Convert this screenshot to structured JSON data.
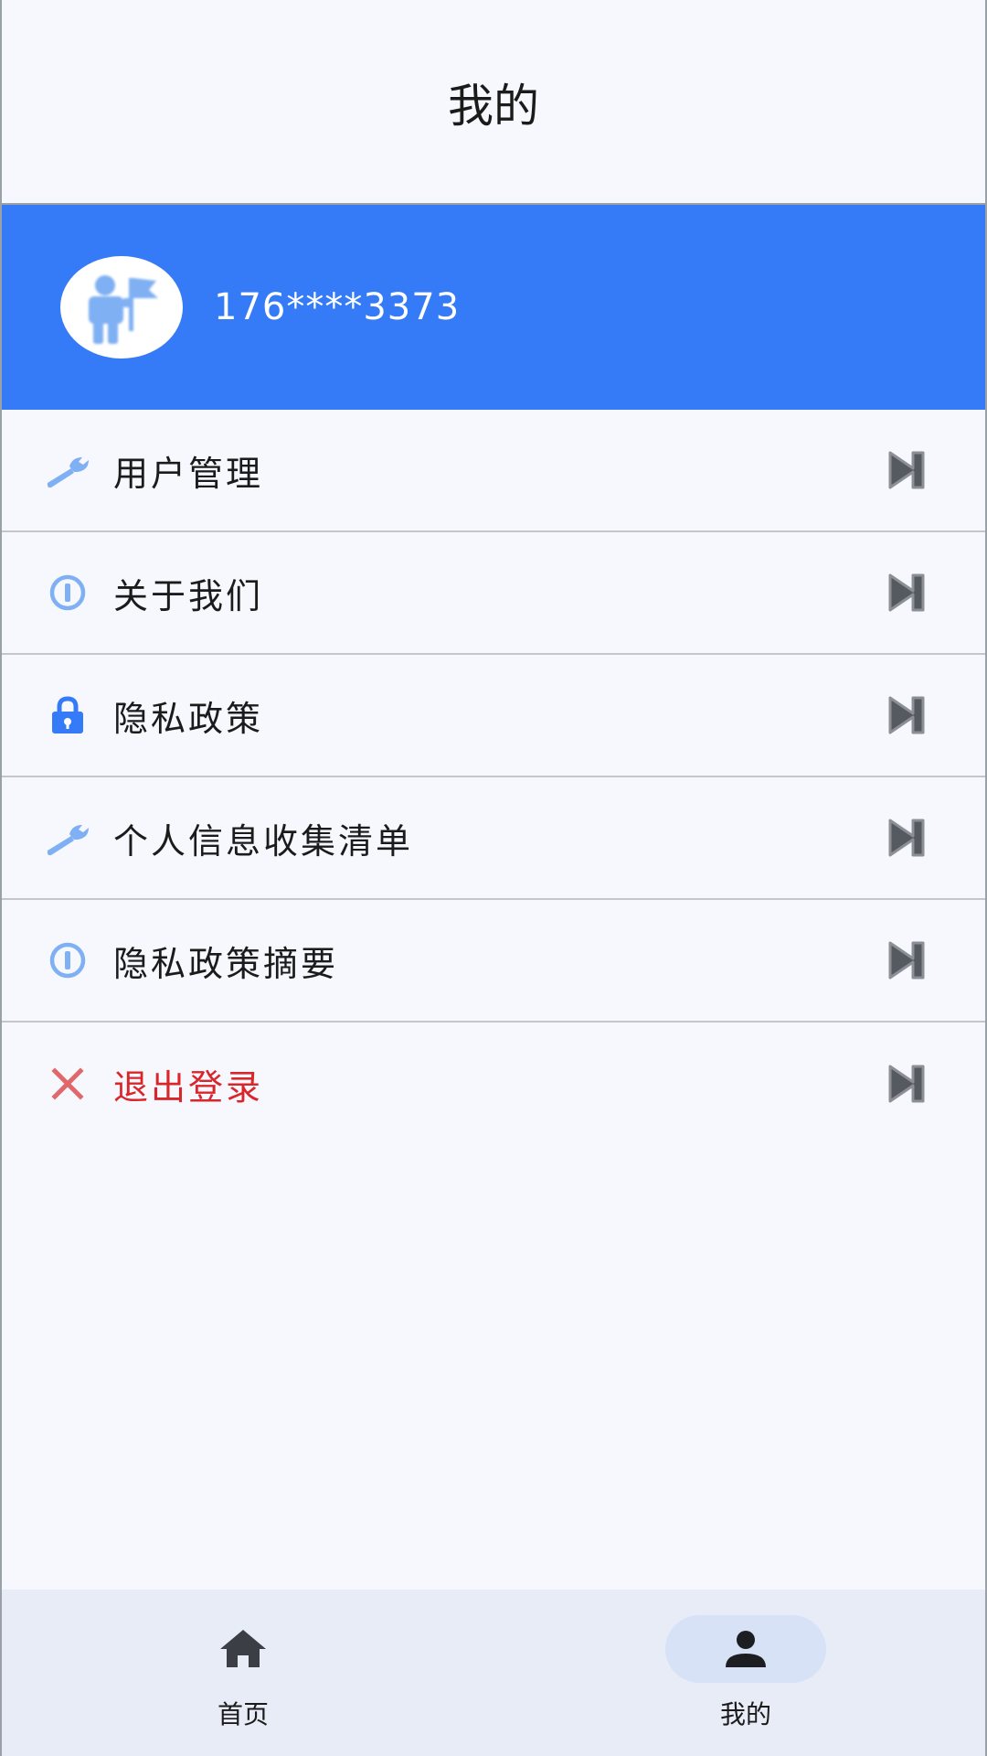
{
  "header": {
    "title": "我的"
  },
  "profile": {
    "phone": "176****3373"
  },
  "menu": {
    "items": [
      {
        "label": "用户管理",
        "icon": "wrench-icon"
      },
      {
        "label": "关于我们",
        "icon": "info-icon"
      },
      {
        "label": "隐私政策",
        "icon": "lock-icon"
      },
      {
        "label": "个人信息收集清单",
        "icon": "wrench-icon"
      },
      {
        "label": "隐私政策摘要",
        "icon": "info-icon"
      },
      {
        "label": "退出登录",
        "icon": "close-icon"
      }
    ]
  },
  "nav": {
    "home": "首页",
    "mine": "我的",
    "active": "mine"
  },
  "colors": {
    "brand": "#357af6",
    "danger": "#d9262b",
    "icon_light": "#7fb0f3"
  }
}
